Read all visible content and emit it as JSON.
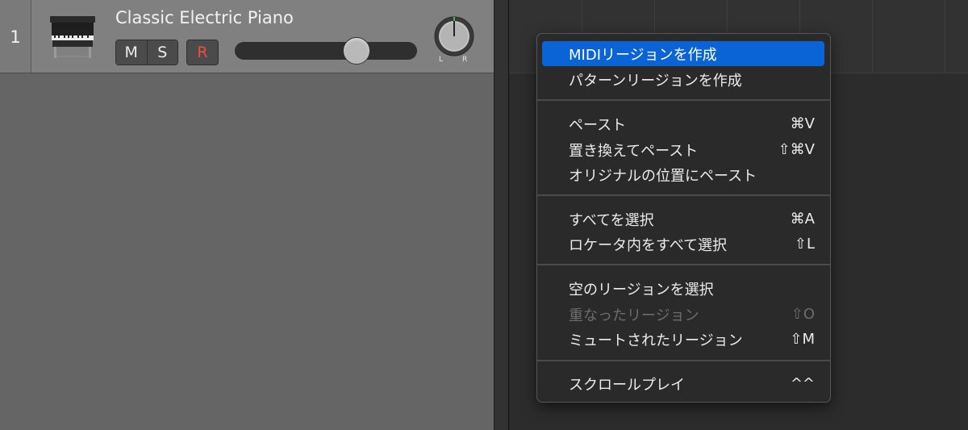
{
  "track": {
    "number": "1",
    "name": "Classic Electric Piano",
    "mute_label": "M",
    "solo_label": "S",
    "record_label": "R",
    "pan_left": "L",
    "pan_right": "R",
    "volume_level": 0.7
  },
  "context_menu": {
    "items": [
      {
        "label": "MIDIリージョンを作成",
        "shortcut": "",
        "highlighted": true
      },
      {
        "label": "パターンリージョンを作成",
        "shortcut": ""
      },
      {
        "label": "ペースト",
        "shortcut": "⌘V"
      },
      {
        "label": "置き換えてペースト",
        "shortcut": "⇧⌘V"
      },
      {
        "label": "オリジナルの位置にペースト",
        "shortcut": ""
      },
      {
        "label": "すべてを選択",
        "shortcut": "⌘A"
      },
      {
        "label": "ロケータ内をすべて選択",
        "shortcut": "⇧L"
      },
      {
        "label": "空のリージョンを選択",
        "shortcut": ""
      },
      {
        "label": "重なったリージョン",
        "shortcut": "⇧O",
        "disabled": true
      },
      {
        "label": "ミュートされたリージョン",
        "shortcut": "⇧M"
      },
      {
        "label": "スクロールプレイ",
        "shortcut": "^^"
      }
    ]
  },
  "colors": {
    "menu_highlight": "#0a64d5",
    "record_red": "#f04d3f"
  },
  "icons": [
    "piano-icon",
    "pan-knob-icon"
  ]
}
